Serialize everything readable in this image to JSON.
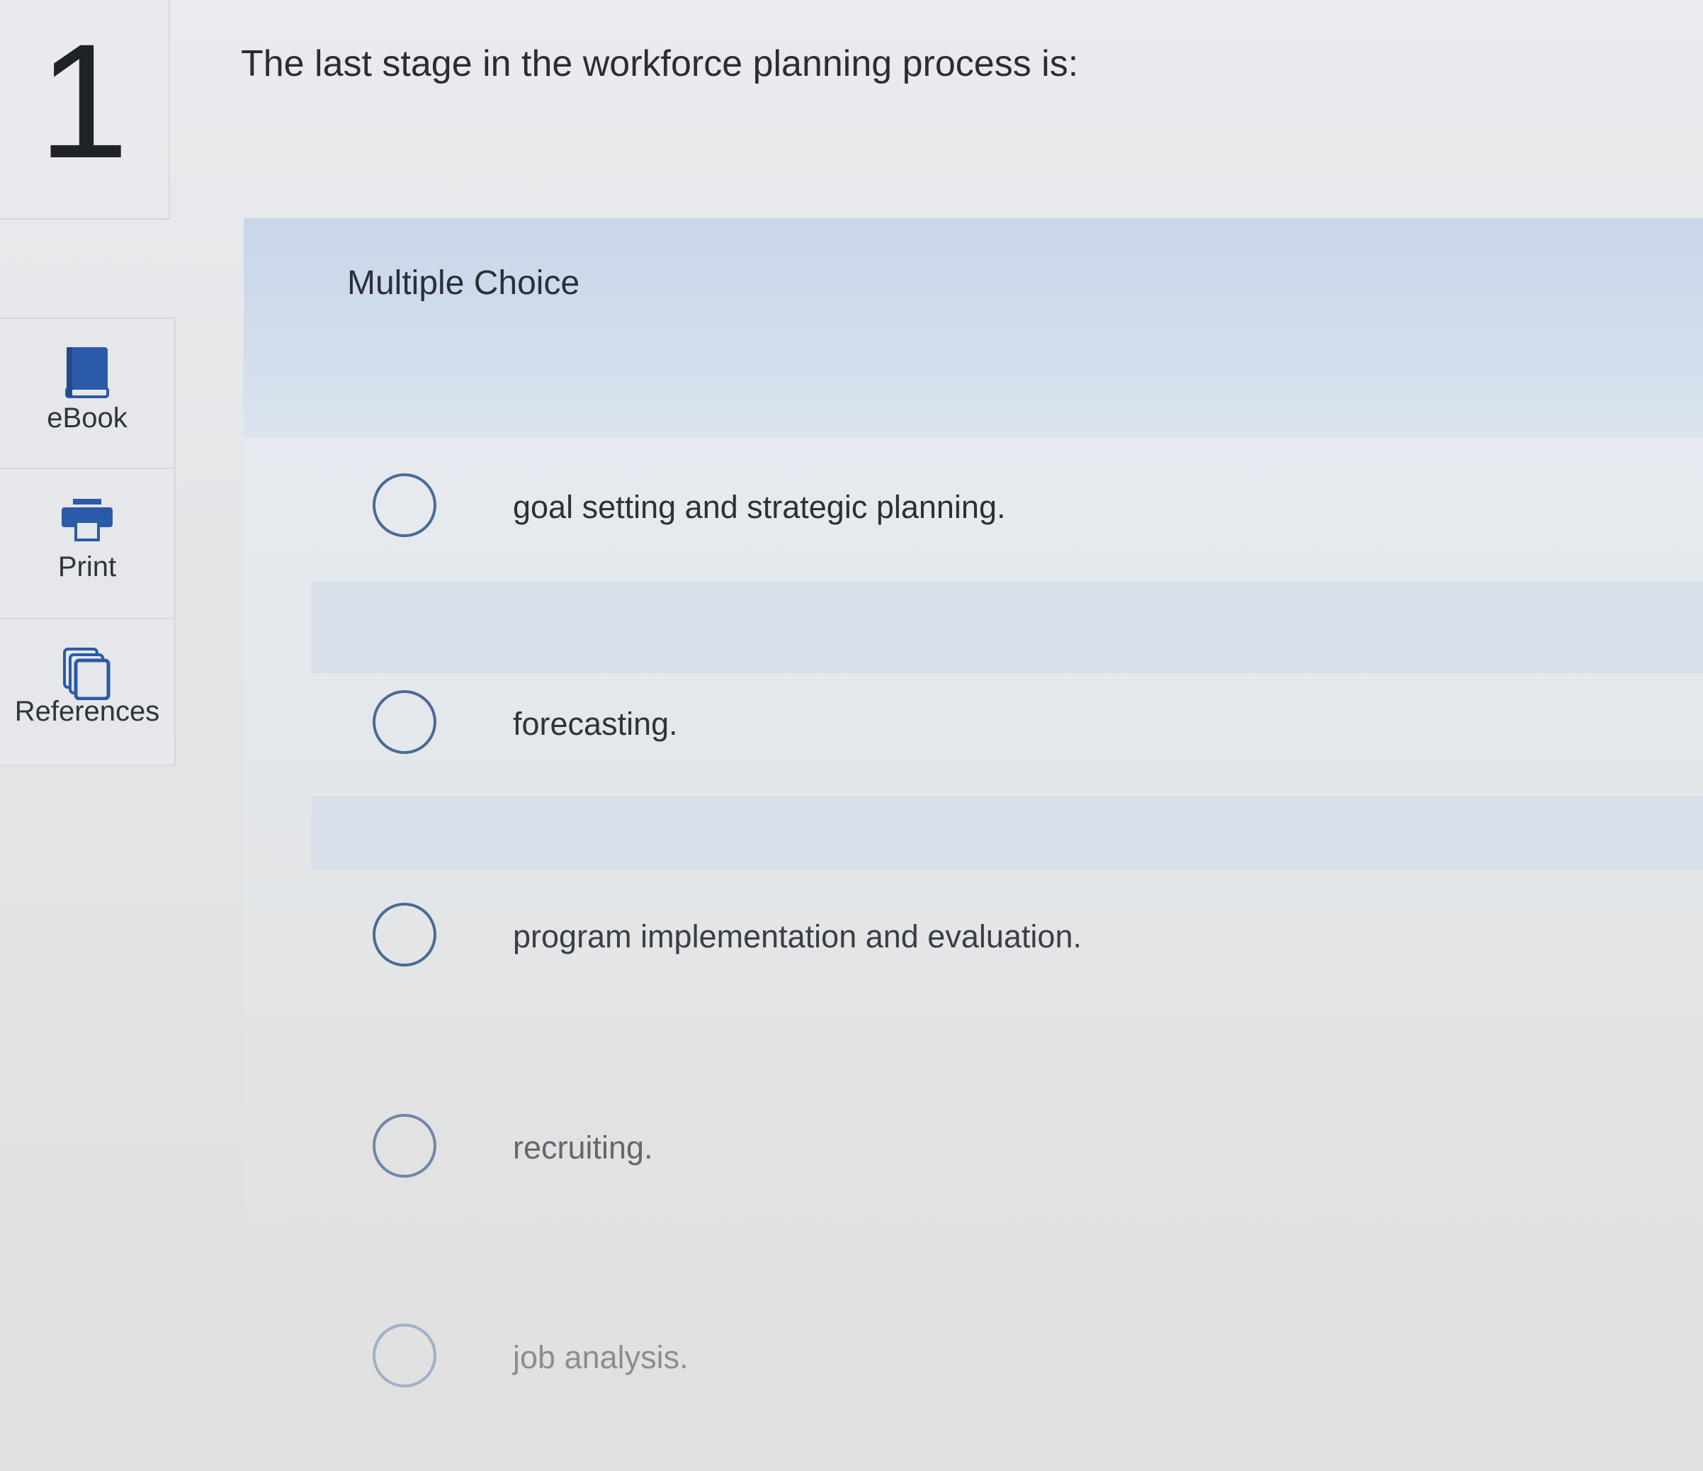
{
  "question": {
    "number": "1",
    "text": "The last stage in the workforce planning process is:",
    "type_label": "Multiple Choice"
  },
  "tools": [
    {
      "label": "eBook",
      "icon": "book-icon"
    },
    {
      "label": "Print",
      "icon": "printer-icon"
    },
    {
      "label": "References",
      "icon": "references-icon"
    }
  ],
  "options": [
    {
      "text": "goal setting and strategic planning.",
      "selected": false
    },
    {
      "text": "forecasting.",
      "selected": false
    },
    {
      "text": "program implementation and evaluation.",
      "selected": false
    },
    {
      "text": "recruiting.",
      "selected": false
    },
    {
      "text": "job analysis.",
      "selected": false
    }
  ],
  "colors": {
    "accent": "#2b5aa8",
    "header_band": "#c9d7ea",
    "radio_border": "#4a6b97"
  }
}
